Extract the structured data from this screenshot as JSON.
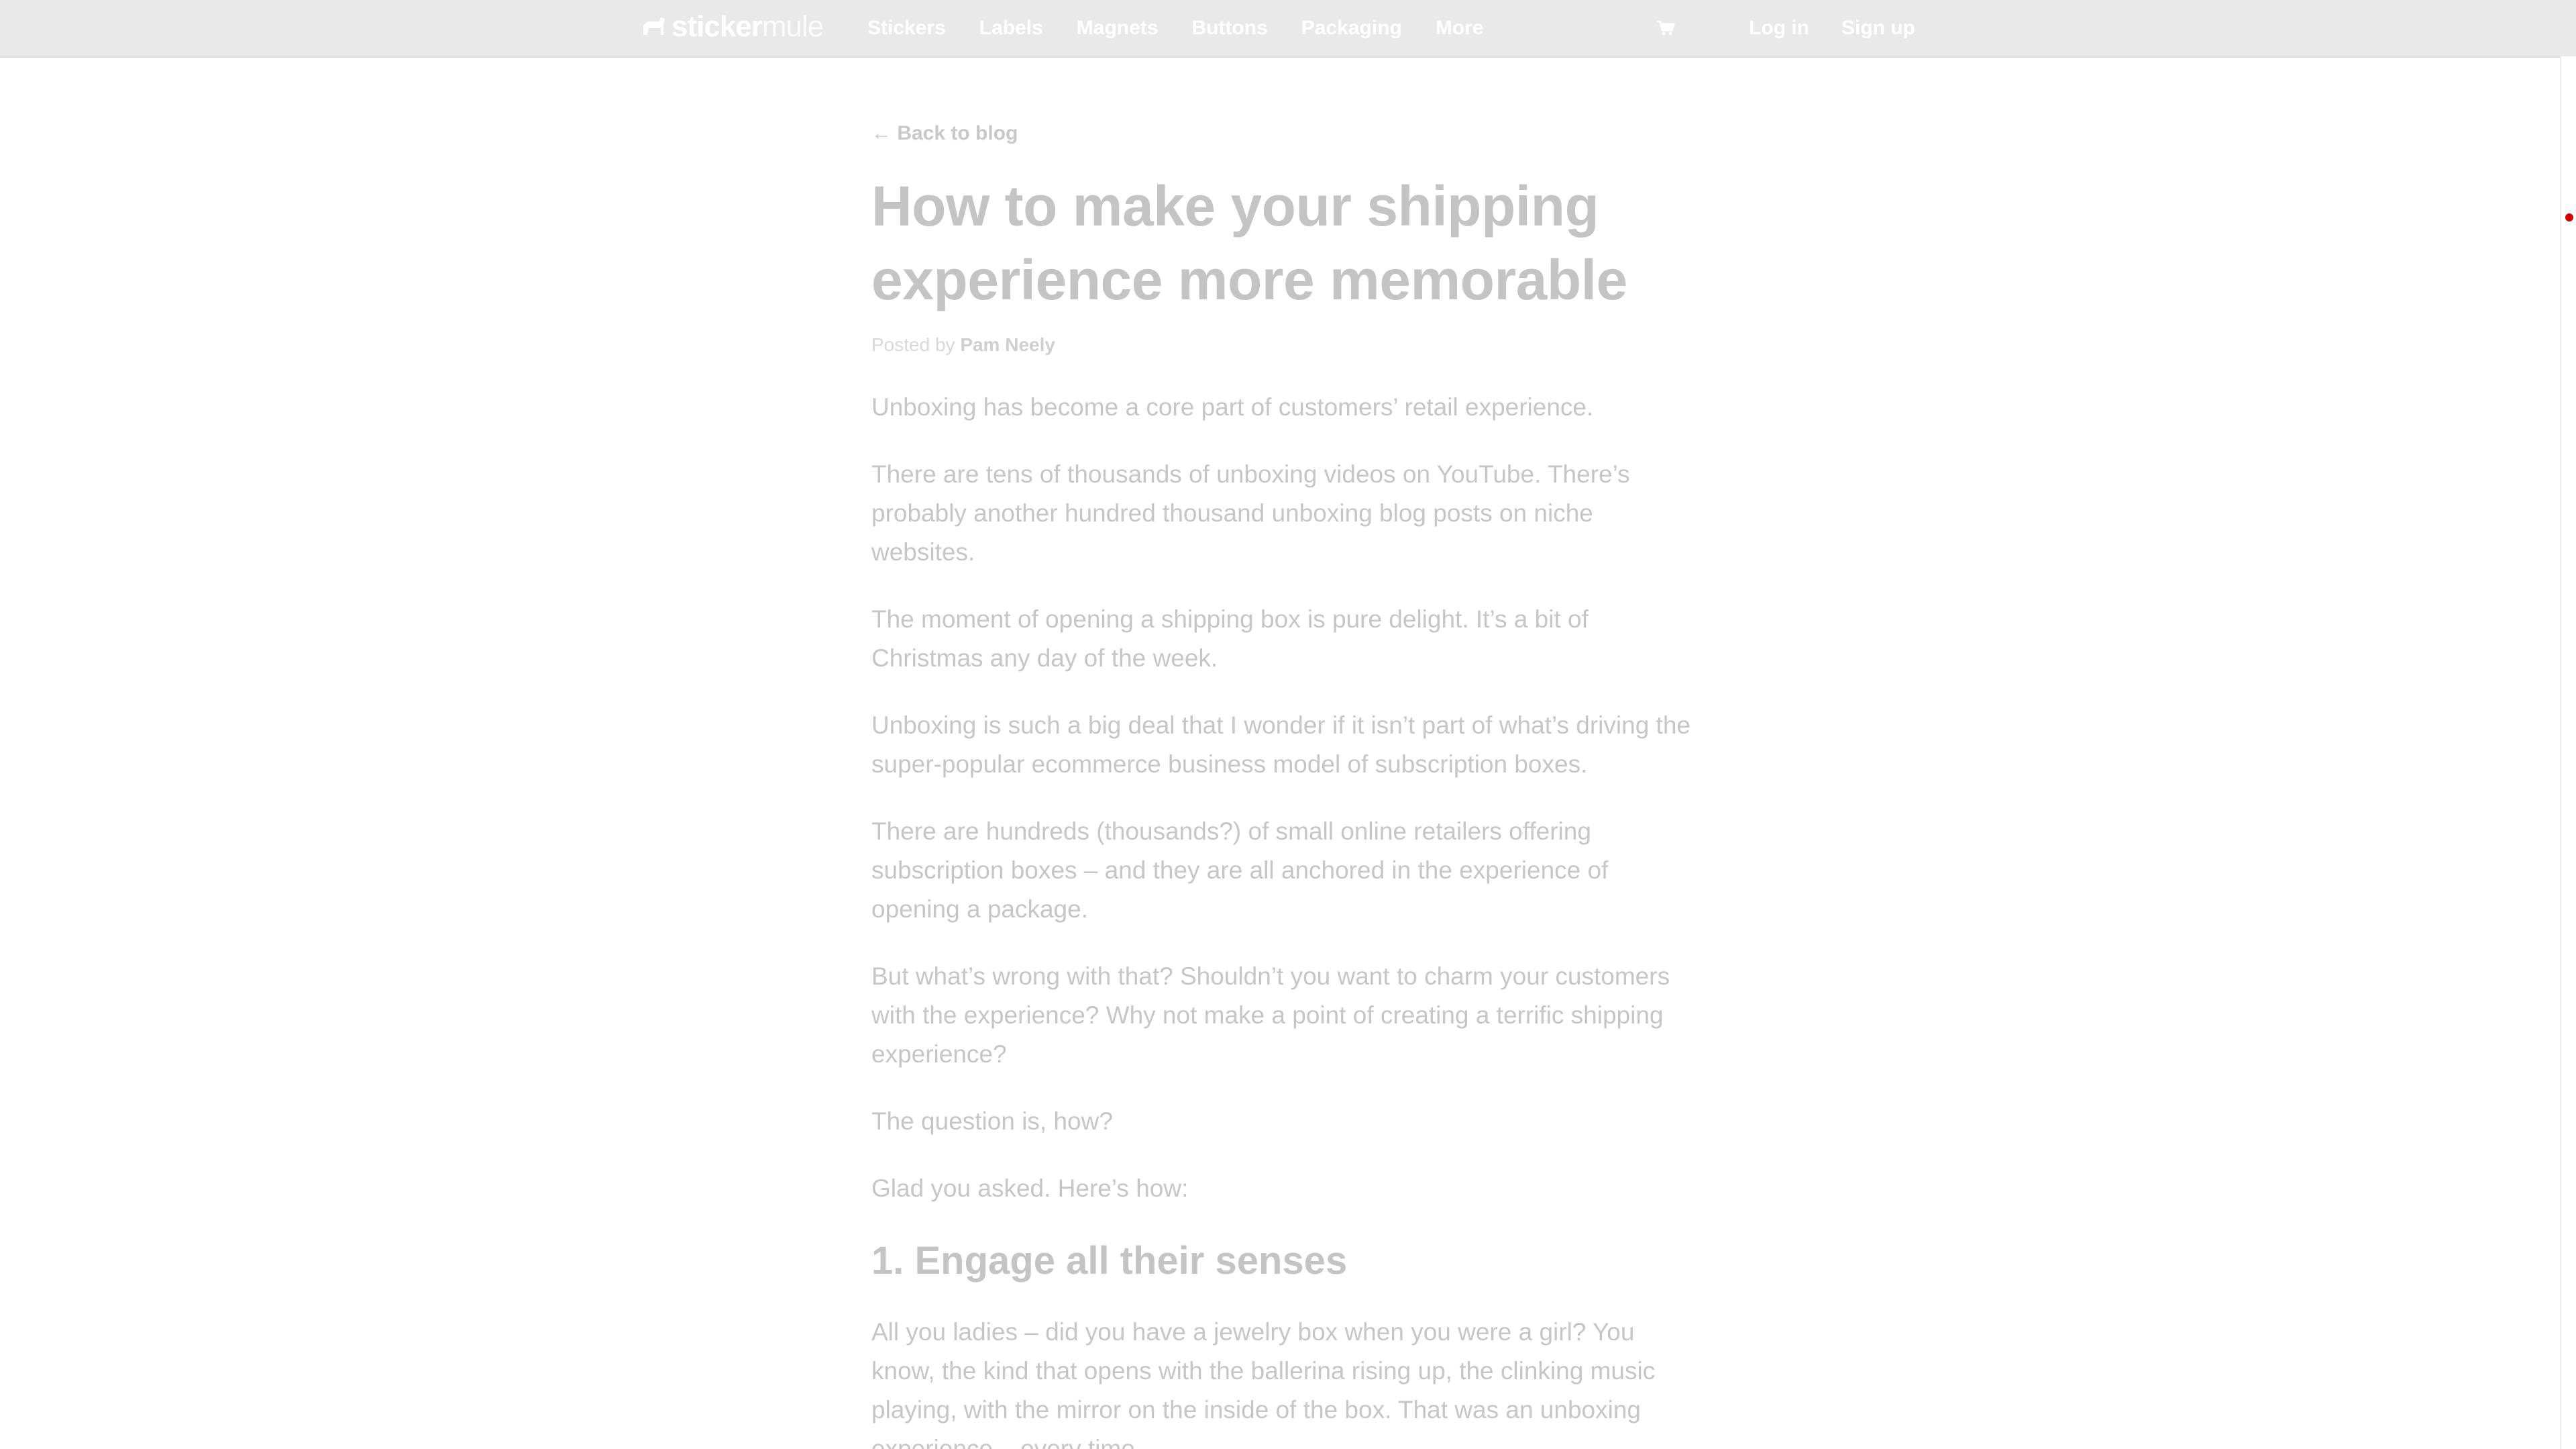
{
  "nav": {
    "logo_bold": "sticker",
    "logo_light": "mule",
    "links": [
      "Stickers",
      "Labels",
      "Magnets",
      "Buttons",
      "Packaging",
      "More"
    ],
    "cart_icon": "cart-icon",
    "login": "Log in",
    "signup": "Sign up"
  },
  "article": {
    "back_link": "← Back to blog",
    "title": "How to make your shipping experience more memorable",
    "byline_prefix": "Posted by ",
    "author": "Pam Neely",
    "paragraphs": [
      "Unboxing has become a core part of customers’ retail experience.",
      "There are tens of thousands of unboxing videos on YouTube. There’s probably another hundred thousand unboxing blog posts on niche websites.",
      "The moment of opening a shipping box is pure delight. It’s a bit of Christmas any day of the week.",
      "Unboxing is such a big deal that I wonder if it isn’t part of what’s driving the super-popular ecommerce business model of subscription boxes.",
      "There are hundreds (thousands?) of small online retailers offering subscription boxes – and they are all anchored in the experience of opening a package.",
      "But what’s wrong with that? Shouldn’t you want to charm your customers with the experience? Why not make a point of creating a terrific shipping experience?",
      "The question is, how?",
      "Glad you asked. Here’s how:"
    ],
    "section_heading": "1. Engage all their senses",
    "section_paragraph": "All you ladies – did you have a jewelry box when you were a girl? You know, the kind that opens with the ballerina rising up, the clinking music playing, with the mirror on the inside of the box. That was an unboxing experience – every time."
  },
  "colors": {
    "nav_bg": "#e9e9e9",
    "scroll_marker": "#d40000"
  }
}
